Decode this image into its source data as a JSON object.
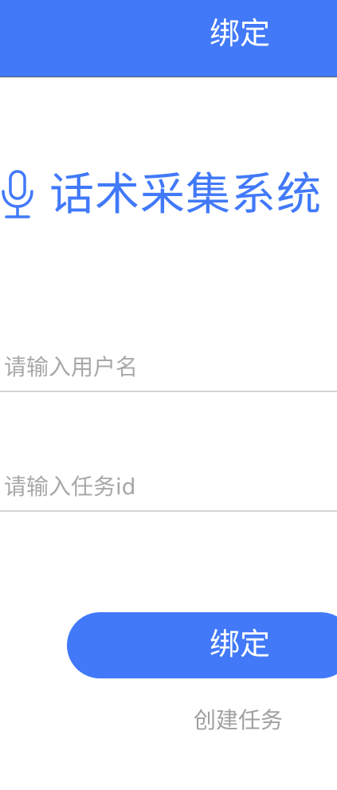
{
  "header": {
    "title": "绑定"
  },
  "brand": {
    "icon": "microphone-icon",
    "title": "话术采集系统"
  },
  "form": {
    "username": {
      "placeholder": "请输入用户名",
      "value": ""
    },
    "task_id": {
      "placeholder": "请输入任务id",
      "value": ""
    },
    "bind_label": "绑定",
    "create_task_label": "创建任务"
  },
  "colors": {
    "primary": "#4179f9",
    "placeholder": "#a8a8a8",
    "divider": "#d4d4d4",
    "link": "#a0a0a0"
  }
}
